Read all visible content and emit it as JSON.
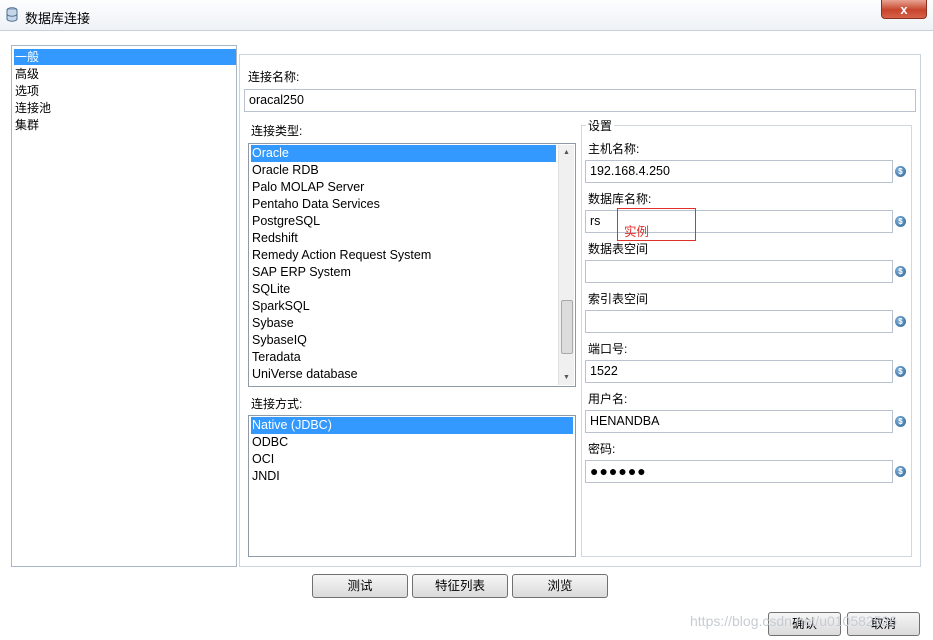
{
  "window": {
    "title": "数据库连接",
    "close_label": "x"
  },
  "nav": {
    "items": [
      "一般",
      "高级",
      "选项",
      "连接池",
      "集群"
    ],
    "selected": 0
  },
  "connection_name": {
    "label": "连接名称:",
    "value": "oracal250"
  },
  "connection_type": {
    "label": "连接类型:",
    "items": [
      "Oracle",
      "Oracle RDB",
      "Palo MOLAP Server",
      "Pentaho Data Services",
      "PostgreSQL",
      "Redshift",
      "Remedy Action Request System",
      "SAP ERP System",
      "SQLite",
      "SparkSQL",
      "Sybase",
      "SybaseIQ",
      "Teradata",
      "UniVerse database"
    ],
    "selected": 0
  },
  "access_method": {
    "label": "连接方式:",
    "items": [
      "Native (JDBC)",
      "ODBC",
      "OCI",
      "JNDI"
    ],
    "selected": 0
  },
  "settings": {
    "title": "设置",
    "host": {
      "label": "主机名称:",
      "value": "192.168.4.250"
    },
    "database": {
      "label": "数据库名称:",
      "value": "rs"
    },
    "data_tablespace": {
      "label": "数据表空间",
      "value": ""
    },
    "index_tablespace": {
      "label": "索引表空间",
      "value": ""
    },
    "port": {
      "label": "端口号:",
      "value": "1522"
    },
    "username": {
      "label": "用户名:",
      "value": "HENANDBA"
    },
    "password": {
      "label": "密码:",
      "value": "●●●●●●"
    },
    "variable_icon": "$"
  },
  "annotation": {
    "text": "实例",
    "color": "#e0302a"
  },
  "buttons": {
    "test": "测试",
    "feature_list": "特征列表",
    "explore": "浏览",
    "ok": "确认",
    "cancel": "取消"
  },
  "watermark": "https://blog.csdn.net/u010582526",
  "colors": {
    "selection": "#3399ff",
    "close": "#c7452c",
    "annotation": "#e0302a"
  }
}
